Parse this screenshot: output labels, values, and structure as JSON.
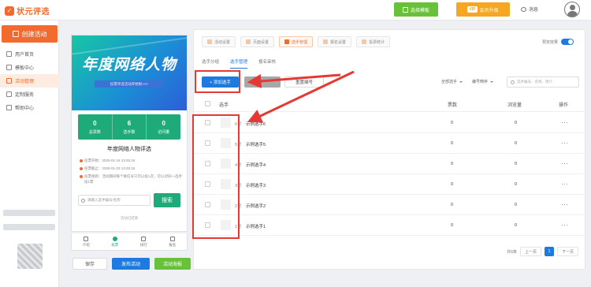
{
  "header": {
    "logo_text": "状元评选",
    "template_btn": "选择模板",
    "vip_badge": "VIP",
    "vip_btn": "会员升级",
    "message": "消息"
  },
  "sidebar": {
    "create_label": "创建活动",
    "items": [
      {
        "label": "用户首页",
        "active": false
      },
      {
        "label": "模板中心",
        "active": false
      },
      {
        "label": "活动管理",
        "active": true
      },
      {
        "label": "定制服务",
        "active": false
      },
      {
        "label": "帮助中心",
        "active": false
      }
    ]
  },
  "preview": {
    "banner_title": "年度网络人物",
    "banner_sub": "投票评选活动开始啦>>>",
    "stats": [
      {
        "value": "0",
        "label": "总票数"
      },
      {
        "value": "6",
        "label": "选手数"
      },
      {
        "value": "0",
        "label": "访问量"
      }
    ],
    "event_name": "年度网络人物评选",
    "info": [
      "投票开始：2025-01-16 13:45:16",
      "投票截止：2025-01-23 13:45:16",
      "投票规则：活动期间每个微信号只可以投1次，可以对同一选手投1票"
    ],
    "search_placeholder": "请输入选手编号/名称",
    "search_btn": "搜索",
    "note": "活动已结束",
    "tabs": [
      {
        "label": "介绍",
        "active": false
      },
      {
        "label": "投票",
        "active": true
      },
      {
        "label": "排行",
        "active": false
      },
      {
        "label": "报名",
        "active": false
      }
    ],
    "buttons": {
      "draft": "保存",
      "publish": "发布活动",
      "poster": "活动海报"
    }
  },
  "content": {
    "steps": [
      {
        "label": "活动设置",
        "active": false
      },
      {
        "label": "页面设置",
        "active": false
      },
      {
        "label": "选手管理",
        "active": true
      },
      {
        "label": "报名设置",
        "active": false
      },
      {
        "label": "投票统计",
        "active": false
      }
    ],
    "preview_label": "预览效果",
    "subtabs": [
      {
        "label": "选手分组",
        "active": false
      },
      {
        "label": "选手管理",
        "active": true
      },
      {
        "label": "报名审核",
        "active": false
      }
    ],
    "add_btn": "+ 添加选手",
    "reset_btn": "重置编号",
    "filter_all": "全部选手",
    "filter_sort": "编号倒序",
    "search_placeholder": "选手编号、名称、简介",
    "columns": {
      "player": "选手",
      "votes": "票数",
      "views": "浏览量",
      "actions": "操作"
    },
    "rows": [
      {
        "num": "6号",
        "name": "示例选手6",
        "votes": "0",
        "views": "0",
        "more": "···"
      },
      {
        "num": "5号",
        "name": "示例选手5",
        "votes": "0",
        "views": "0",
        "more": "···"
      },
      {
        "num": "4号",
        "name": "示例选手4",
        "votes": "0",
        "views": "0",
        "more": "···"
      },
      {
        "num": "3号",
        "name": "示例选手3",
        "votes": "0",
        "views": "0",
        "more": "···"
      },
      {
        "num": "2号",
        "name": "示例选手2",
        "votes": "0",
        "views": "0",
        "more": "···"
      },
      {
        "num": "1号",
        "name": "示例选手1",
        "votes": "0",
        "views": "0",
        "more": "···"
      }
    ],
    "pager": {
      "total": "共6条",
      "prev": "上一页",
      "current": "1",
      "next": "下一页"
    }
  },
  "colors": {
    "brand": "#f26a2e",
    "primary": "#1f7ae0",
    "success": "#67c23a",
    "annotation": "#e53935"
  }
}
